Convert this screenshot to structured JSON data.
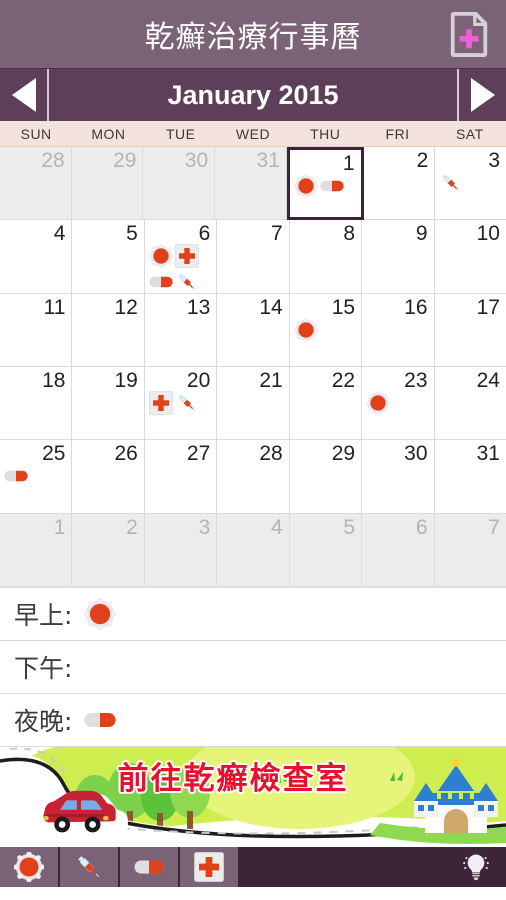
{
  "app": {
    "title": "乾癬治療行事曆",
    "add_button_icon": "add-document-icon"
  },
  "month_nav": {
    "prev_label": "◀",
    "next_label": "▶",
    "current_month": "January 2015"
  },
  "weekdays": [
    "SUN",
    "MON",
    "TUE",
    "WED",
    "THU",
    "FRI",
    "SAT"
  ],
  "calendar": {
    "weeks": [
      [
        {
          "num": "28",
          "other": true,
          "selected": false,
          "icons": []
        },
        {
          "num": "29",
          "other": true,
          "selected": false,
          "icons": []
        },
        {
          "num": "30",
          "other": true,
          "selected": false,
          "icons": []
        },
        {
          "num": "31",
          "other": true,
          "selected": false,
          "icons": []
        },
        {
          "num": "1",
          "other": false,
          "selected": true,
          "icons": [
            "sun",
            "capsule"
          ]
        },
        {
          "num": "2",
          "other": false,
          "selected": false,
          "icons": []
        },
        {
          "num": "3",
          "other": false,
          "selected": false,
          "icons": [
            "syringe"
          ]
        }
      ],
      [
        {
          "num": "4",
          "other": false,
          "selected": false,
          "icons": []
        },
        {
          "num": "5",
          "other": false,
          "selected": false,
          "icons": []
        },
        {
          "num": "6",
          "other": false,
          "selected": false,
          "icons": [
            "sun",
            "redcross",
            "capsule",
            "syringe"
          ]
        },
        {
          "num": "7",
          "other": false,
          "selected": false,
          "icons": []
        },
        {
          "num": "8",
          "other": false,
          "selected": false,
          "icons": []
        },
        {
          "num": "9",
          "other": false,
          "selected": false,
          "icons": []
        },
        {
          "num": "10",
          "other": false,
          "selected": false,
          "icons": []
        }
      ],
      [
        {
          "num": "11",
          "other": false,
          "selected": false,
          "icons": []
        },
        {
          "num": "12",
          "other": false,
          "selected": false,
          "icons": []
        },
        {
          "num": "13",
          "other": false,
          "selected": false,
          "icons": []
        },
        {
          "num": "14",
          "other": false,
          "selected": false,
          "icons": []
        },
        {
          "num": "15",
          "other": false,
          "selected": false,
          "icons": [
            "sun"
          ]
        },
        {
          "num": "16",
          "other": false,
          "selected": false,
          "icons": []
        },
        {
          "num": "17",
          "other": false,
          "selected": false,
          "icons": []
        }
      ],
      [
        {
          "num": "18",
          "other": false,
          "selected": false,
          "icons": []
        },
        {
          "num": "19",
          "other": false,
          "selected": false,
          "icons": []
        },
        {
          "num": "20",
          "other": false,
          "selected": false,
          "icons": [
            "redcross",
            "syringe"
          ]
        },
        {
          "num": "21",
          "other": false,
          "selected": false,
          "icons": []
        },
        {
          "num": "22",
          "other": false,
          "selected": false,
          "icons": []
        },
        {
          "num": "23",
          "other": false,
          "selected": false,
          "icons": [
            "sun"
          ]
        },
        {
          "num": "24",
          "other": false,
          "selected": false,
          "icons": []
        }
      ],
      [
        {
          "num": "25",
          "other": false,
          "selected": false,
          "icons": [
            "capsule"
          ]
        },
        {
          "num": "26",
          "other": false,
          "selected": false,
          "icons": []
        },
        {
          "num": "27",
          "other": false,
          "selected": false,
          "icons": []
        },
        {
          "num": "28",
          "other": false,
          "selected": false,
          "icons": []
        },
        {
          "num": "29",
          "other": false,
          "selected": false,
          "icons": []
        },
        {
          "num": "30",
          "other": false,
          "selected": false,
          "icons": []
        },
        {
          "num": "31",
          "other": false,
          "selected": false,
          "icons": []
        }
      ],
      [
        {
          "num": "1",
          "other": true,
          "selected": false,
          "icons": []
        },
        {
          "num": "2",
          "other": true,
          "selected": false,
          "icons": []
        },
        {
          "num": "3",
          "other": true,
          "selected": false,
          "icons": []
        },
        {
          "num": "4",
          "other": true,
          "selected": false,
          "icons": []
        },
        {
          "num": "5",
          "other": true,
          "selected": false,
          "icons": []
        },
        {
          "num": "6",
          "other": true,
          "selected": false,
          "icons": []
        },
        {
          "num": "7",
          "other": true,
          "selected": false,
          "icons": []
        }
      ]
    ]
  },
  "details": [
    {
      "label": "早上:",
      "icons": [
        "sun"
      ]
    },
    {
      "label": "下午:",
      "icons": []
    },
    {
      "label": "夜晚:",
      "icons": [
        "capsule"
      ]
    }
  ],
  "ad": {
    "text": "前往乾癬檢查室",
    "elements": [
      "road",
      "car",
      "trees",
      "castle",
      "sun-glow"
    ]
  },
  "toolbar": {
    "buttons": [
      "sun",
      "syringe",
      "capsule",
      "redcross"
    ],
    "right_icon": "lightbulb-icon"
  },
  "colors": {
    "title_bar": "#7a6277",
    "month_bar": "#5d3f5a",
    "weekday_bar": "#f4e2dd",
    "toolbar_dark": "#3d2438",
    "accent_red": "#e0401a",
    "add_plus": "#ee5fd6"
  }
}
